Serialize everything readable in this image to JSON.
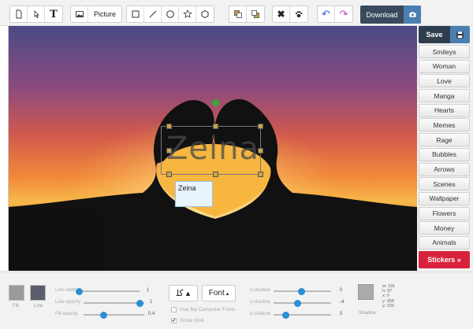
{
  "toolbar": {
    "picture_label": "Picture",
    "download_label": "Download"
  },
  "sidebar": {
    "save_label": "Save",
    "categories": [
      "Smileys",
      "Woman",
      "Love",
      "Manga",
      "Hearts",
      "Memes",
      "Rage",
      "Bubbles",
      "Arrows",
      "Scenes",
      "Wallpaper",
      "Flowers",
      "Money",
      "Animals"
    ],
    "stickers_label": "Stickers »"
  },
  "canvas": {
    "text_object": "Zeina",
    "text_input_value": "Zeina"
  },
  "bottom": {
    "fill_label": "Fill",
    "line_label": "Line",
    "fill_color": "#9a9a9a",
    "line_color": "#5a5d6b",
    "line_width_label": "Line-width",
    "line_width_value": "1",
    "line_opacity_label": "Line-opacity",
    "line_opacity_value": "1",
    "fill_opacity_label": "Fill-opacity",
    "fill_opacity_value": "0.4",
    "font_label": "Font",
    "use_computer_fonts_label": "Use My Computer Fonts",
    "show_grid_label": "Show Grid",
    "xshadow_label": "x-shadow",
    "xshadow_value": "0",
    "yshadow_label": "y-shadow",
    "yshadow_value": "-4",
    "bshadow_label": "b-shadow",
    "bshadow_value": "5",
    "shadow_label": "Shadow",
    "dims": [
      "w: 191",
      "h: 97",
      "x: 0",
      "y: 358",
      "y: 220"
    ]
  },
  "colors": {
    "accent_blue": "#2a8fd4",
    "stickers_red": "#d8223d",
    "dark_navy": "#2f3e4e"
  }
}
